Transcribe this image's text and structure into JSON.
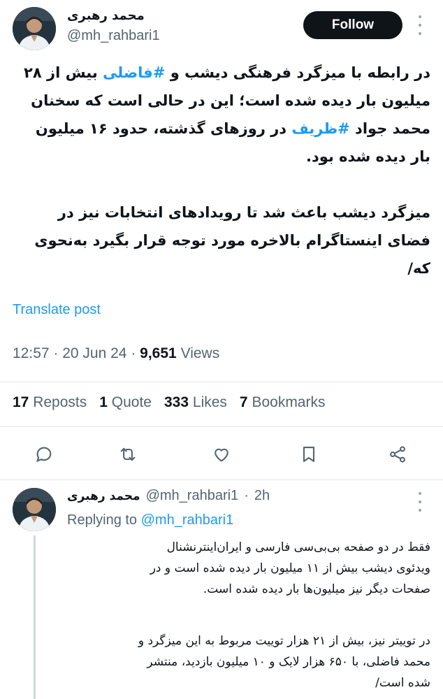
{
  "author": {
    "name": "محمد رهبری",
    "handle": "@mh_rahbari1"
  },
  "follow_label": "Follow",
  "tweet": {
    "line1_before": "در رابطه با میزگرد فرهنگی دیشب و ",
    "hashtag1": "#فاضلی",
    "line1_after": " بیش از ۲۸",
    "line2": "میلیون بار دیده شده است؛ این در حالی است که سخنان",
    "line3_before": "محمد جواد ",
    "hashtag2": "#ظریف",
    "line3_after": " در روزهای گذشته، حدود ۱۶ میلیون",
    "line4": "بار دیده شده بود.",
    "line5": "میزگرد دیشب باعث شد تا رویدادهای انتخابات نیز در",
    "line6": "فضای اینستاگرام بالاخره مورد توجه قرار بگیرد به‌نحوی",
    "line7": "که/"
  },
  "translate_label": "Translate post",
  "meta": {
    "time": "12:57",
    "date": "20 Jun 24",
    "views_count": "9,651",
    "views_label": "Views"
  },
  "stats": {
    "reposts_count": "17",
    "reposts_label": "Reposts",
    "quotes_count": "1",
    "quotes_label": "Quote",
    "likes_count": "333",
    "likes_label": "Likes",
    "bookmarks_count": "7",
    "bookmarks_label": "Bookmarks"
  },
  "reply": {
    "name": "محمد رهبری",
    "handle": "@mh_rahbari1",
    "age": "2h",
    "replying_prefix": "Replying to",
    "replying_handle": "@mh_rahbari1",
    "line1": "فقط در دو صفحه بی‌بی‌سی فارسی و ایران‌اینترنشنال",
    "line2": "ویدئوی دیشب بیش از ۱۱ میلیون بار دیده شده است و در",
    "line3": "صفحات دیگر نیز میلیون‌ها بار دیده شده است.",
    "line4": "در توییتر نیز، بیش از ۲۱ هزار توییت مربوط به این میزگرد و",
    "line5": "محمد فاضلی، با ۶۵۰ هزار لایک و ۱۰ میلیون بازدید، منتشر",
    "line6": "شده است/"
  },
  "colors": {
    "accent": "#1d9bf0",
    "text": "#0f1419",
    "muted": "#536471",
    "follow_bg": "#0f1419"
  },
  "icons": [
    "more-icon",
    "reply-icon",
    "repost-icon",
    "like-icon",
    "bookmark-icon",
    "share-icon"
  ]
}
